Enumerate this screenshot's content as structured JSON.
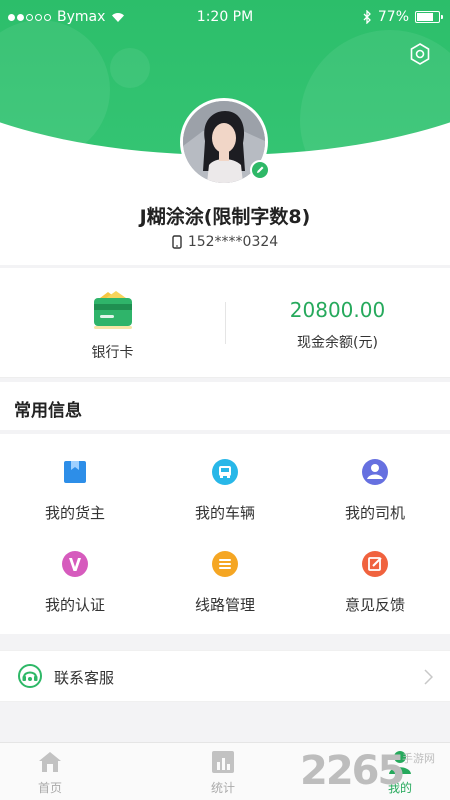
{
  "status_bar": {
    "carrier": "Bymax",
    "time": "1:20 PM",
    "battery": "77%",
    "battery_level": 0.77,
    "signal_bars_filled": 2
  },
  "profile": {
    "username": "J糊涂涂(限制字数8)",
    "phone": "152****0324"
  },
  "wallet": {
    "bank_card_label": "银行卡",
    "balance_value": "20800.00",
    "balance_label": "现金余额(元)"
  },
  "common_info": {
    "title": "常用信息",
    "items": [
      {
        "label": "我的货主",
        "icon": "shipper-icon",
        "color": "#2d8ee8"
      },
      {
        "label": "我的车辆",
        "icon": "vehicle-icon",
        "color": "#28b7e8"
      },
      {
        "label": "我的司机",
        "icon": "driver-icon",
        "color": "#6670e0"
      },
      {
        "label": "我的认证",
        "icon": "certification-icon",
        "color": "#d65bbd"
      },
      {
        "label": "线路管理",
        "icon": "route-icon",
        "color": "#f5a623"
      },
      {
        "label": "意见反馈",
        "icon": "feedback-icon",
        "color": "#f0623e"
      }
    ]
  },
  "support": {
    "label": "联系客服"
  },
  "tabbar": {
    "tabs": [
      {
        "label": "首页",
        "icon": "home-icon"
      },
      {
        "label": "统计",
        "icon": "stats-icon"
      },
      {
        "label": "我的",
        "icon": "profile-icon",
        "active": true
      }
    ]
  },
  "watermark": {
    "number": "2265",
    "text": "手游网"
  },
  "colors": {
    "primary_green": "#26a95c",
    "header_green": "#2cbe6a"
  }
}
